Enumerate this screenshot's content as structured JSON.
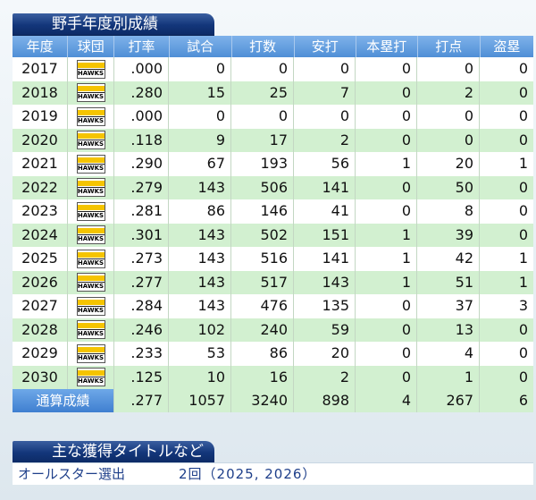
{
  "stats_section": {
    "title": "野手年度別成績",
    "headers": [
      "年度",
      "球団",
      "打率",
      "試合",
      "打数",
      "安打",
      "本塁打",
      "打点",
      "盗塁"
    ],
    "team_logo_text": "HAWKS",
    "rows": [
      {
        "year": "2017",
        "avg": ".000",
        "g": "0",
        "ab": "0",
        "h": "0",
        "hr": "0",
        "rbi": "0",
        "sb": "0"
      },
      {
        "year": "2018",
        "avg": ".280",
        "g": "15",
        "ab": "25",
        "h": "7",
        "hr": "0",
        "rbi": "2",
        "sb": "0"
      },
      {
        "year": "2019",
        "avg": ".000",
        "g": "0",
        "ab": "0",
        "h": "0",
        "hr": "0",
        "rbi": "0",
        "sb": "0"
      },
      {
        "year": "2020",
        "avg": ".118",
        "g": "9",
        "ab": "17",
        "h": "2",
        "hr": "0",
        "rbi": "0",
        "sb": "0"
      },
      {
        "year": "2021",
        "avg": ".290",
        "g": "67",
        "ab": "193",
        "h": "56",
        "hr": "1",
        "rbi": "20",
        "sb": "1"
      },
      {
        "year": "2022",
        "avg": ".279",
        "g": "143",
        "ab": "506",
        "h": "141",
        "hr": "0",
        "rbi": "50",
        "sb": "0"
      },
      {
        "year": "2023",
        "avg": ".281",
        "g": "86",
        "ab": "146",
        "h": "41",
        "hr": "0",
        "rbi": "8",
        "sb": "0"
      },
      {
        "year": "2024",
        "avg": ".301",
        "g": "143",
        "ab": "502",
        "h": "151",
        "hr": "1",
        "rbi": "39",
        "sb": "0"
      },
      {
        "year": "2025",
        "avg": ".273",
        "g": "143",
        "ab": "516",
        "h": "141",
        "hr": "1",
        "rbi": "42",
        "sb": "1"
      },
      {
        "year": "2026",
        "avg": ".277",
        "g": "143",
        "ab": "517",
        "h": "143",
        "hr": "1",
        "rbi": "51",
        "sb": "1"
      },
      {
        "year": "2027",
        "avg": ".284",
        "g": "143",
        "ab": "476",
        "h": "135",
        "hr": "0",
        "rbi": "37",
        "sb": "3"
      },
      {
        "year": "2028",
        "avg": ".246",
        "g": "102",
        "ab": "240",
        "h": "59",
        "hr": "0",
        "rbi": "13",
        "sb": "0"
      },
      {
        "year": "2029",
        "avg": ".233",
        "g": "53",
        "ab": "86",
        "h": "20",
        "hr": "0",
        "rbi": "4",
        "sb": "0"
      },
      {
        "year": "2030",
        "avg": ".125",
        "g": "10",
        "ab": "16",
        "h": "2",
        "hr": "0",
        "rbi": "1",
        "sb": "0"
      }
    ],
    "total": {
      "label": "通算成績",
      "avg": ".277",
      "g": "1057",
      "ab": "3240",
      "h": "898",
      "hr": "4",
      "rbi": "267",
      "sb": "6"
    }
  },
  "titles_section": {
    "title": "主な獲得タイトルなど",
    "items": [
      {
        "name": "オールスター選出",
        "count": "2回（2025, 2026）"
      }
    ]
  },
  "colors": {
    "header_blue": "#4f8fd6",
    "title_navy": "#13367a",
    "row_green": "#d2f0d0",
    "row_white": "#ffffff",
    "logo_yellow": "#f5c400"
  }
}
